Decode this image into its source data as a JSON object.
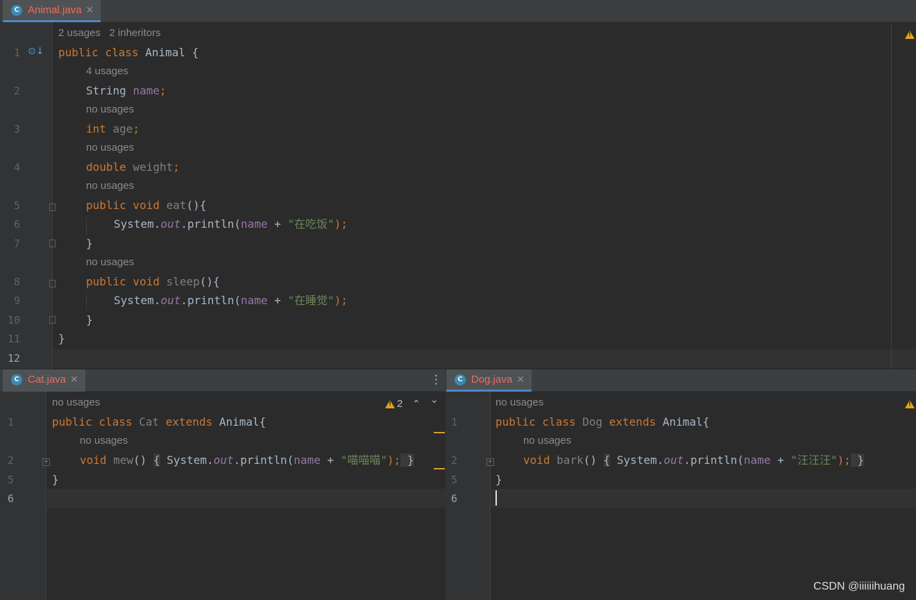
{
  "top_editor": {
    "tab": {
      "icon": "C",
      "label": "Animal.java",
      "close": "✕"
    },
    "hint_class": "2 usages   2 inheritors",
    "lines": [
      {
        "n": "1"
      },
      {
        "n": "2"
      },
      {
        "n": "3"
      },
      {
        "n": "4"
      },
      {
        "n": "5"
      },
      {
        "n": "6"
      },
      {
        "n": "7"
      },
      {
        "n": "8"
      },
      {
        "n": "9"
      },
      {
        "n": "10"
      },
      {
        "n": "11"
      },
      {
        "n": "12"
      }
    ],
    "hints": [
      "4 usages",
      "no usages",
      "no usages",
      "no usages",
      "no usages"
    ],
    "code": {
      "l1": {
        "kw": "public class ",
        "name": "Animal",
        "rest": " {"
      },
      "l2": {
        "type": "String ",
        "field": "name",
        "end": ";"
      },
      "l3": {
        "kw": "int ",
        "field": "age",
        "end": ";"
      },
      "l4": {
        "kw": "double ",
        "field": "weight",
        "end": ";"
      },
      "l5": {
        "kw": "public void ",
        "method": "eat",
        "rest": "(){"
      },
      "l6": {
        "a": "System.",
        "st": "out",
        "b": ".println(",
        "f": "name",
        "c": " + ",
        "s": "\"在吃饭\"",
        "d": ");"
      },
      "l7": "}",
      "l8": {
        "kw": "public void ",
        "method": "sleep",
        "rest": "(){"
      },
      "l9": {
        "a": "System.",
        "st": "out",
        "b": ".println(",
        "f": "name",
        "c": " + ",
        "s": "\"在睡觉\"",
        "d": ");"
      },
      "l10": "}",
      "l11": "}"
    }
  },
  "cat_editor": {
    "tab": {
      "icon": "C",
      "label": "Cat.java",
      "close": "✕"
    },
    "warning_count": "2",
    "lines": [
      {
        "n": "1"
      },
      {
        "n": "2"
      },
      {
        "n": "5"
      },
      {
        "n": "6"
      }
    ],
    "hints": [
      "no usages",
      "no usages"
    ],
    "code": {
      "l1": {
        "kw": "public class ",
        "name": "Cat",
        "ext": " extends ",
        "parent": "Animal",
        "rest": "{"
      },
      "l2": {
        "kw": "void ",
        "method": "mew",
        "p": "() ",
        "ob": "{",
        "a": " System.",
        "st": "out",
        "b": ".println(",
        "f": "name",
        "c": " + ",
        "s": "\"喵喵喵\"",
        "d": ");",
        "cb": " }"
      },
      "l5": "}"
    }
  },
  "dog_editor": {
    "tab": {
      "icon": "C",
      "label": "Dog.java",
      "close": "✕"
    },
    "lines": [
      {
        "n": "1"
      },
      {
        "n": "2"
      },
      {
        "n": "5"
      },
      {
        "n": "6"
      }
    ],
    "hints": [
      "no usages",
      "no usages"
    ],
    "code": {
      "l1": {
        "kw": "public class ",
        "name": "Dog",
        "ext": " extends ",
        "parent": "Animal",
        "rest": "{"
      },
      "l2": {
        "kw": "void ",
        "method": "bark",
        "p": "() ",
        "ob": "{",
        "a": " System.",
        "st": "out",
        "b": ".println(",
        "f": "name",
        "c": " + ",
        "s": "\"汪汪汪\"",
        "d": ");",
        "cb": " }"
      },
      "l5": "}"
    }
  },
  "icons": {
    "gutter_override": "override-down-icon",
    "more": "more-vertical-icon",
    "up": "chevron-up-icon",
    "down": "chevron-down-icon",
    "warning": "warning-icon"
  },
  "colors": {
    "keyword": "#cc7832",
    "field": "#9876aa",
    "string": "#6a8759",
    "tab_label": "#f26a5e",
    "accent": "#4a88c7"
  },
  "symbols": {
    "more": "⋮",
    "up": "⌃",
    "down": "⌄"
  },
  "watermark": "CSDN @iiiiiihuang"
}
